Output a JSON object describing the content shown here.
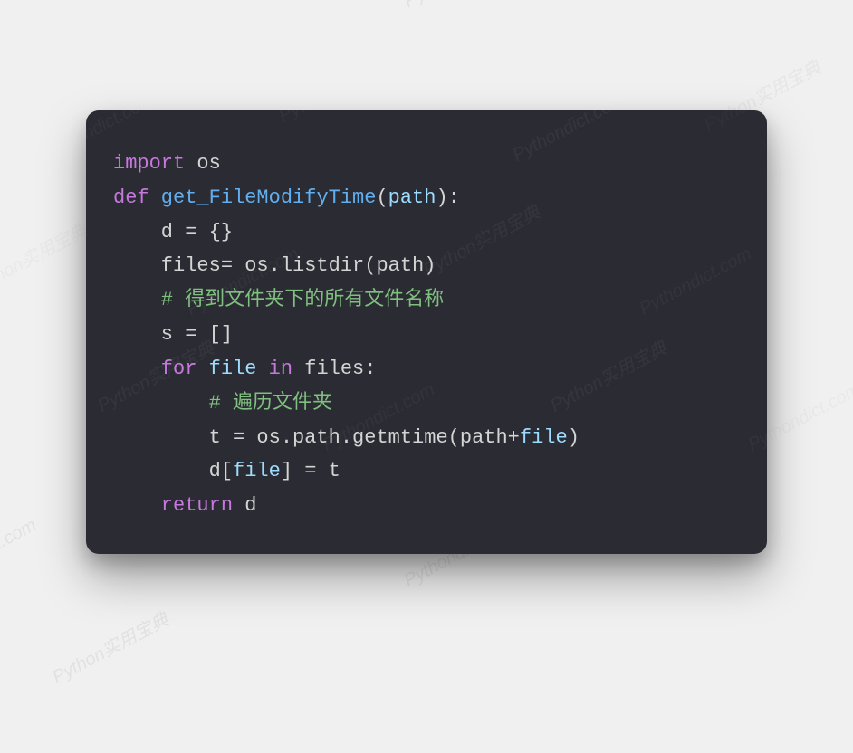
{
  "watermark": {
    "text_en": "Pythondict.com",
    "text_cn": "Python实用宝典"
  },
  "code": {
    "t_import": "import",
    "t_os": " os",
    "t_def": "def",
    "t_fname": " get_FileModifyTime",
    "t_lparen": "(",
    "t_path": "path",
    "t_rparen_colon": "):",
    "t_d_eq": "    d = {}",
    "t_files_eq": "    files= os.listdir(path)",
    "t_comment1": "    # 得到文件夹下的所有文件名称",
    "t_s_eq": "    s = []",
    "t_for": "    for",
    "t_file": " file ",
    "t_in": "in",
    "t_files_colon": " files:",
    "t_comment2": "        # 遍历文件夹",
    "t_t_eq_pre": "        t = os.path.getmtime(path+",
    "t_file2": "file",
    "t_t_eq_post": ")",
    "t_d_idx_pre": "        d[",
    "t_file3": "file",
    "t_d_idx_post": "] = t",
    "t_return": "    return",
    "t_return_d": " d"
  }
}
